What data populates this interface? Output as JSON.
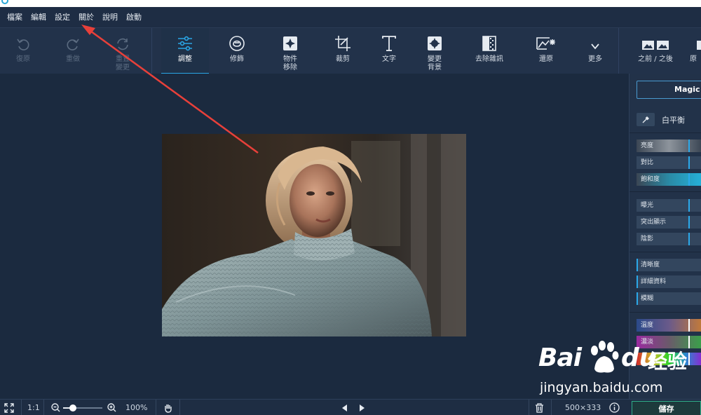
{
  "menu": [
    "檔案",
    "編輯",
    "設定",
    "關於",
    "說明",
    "啟動"
  ],
  "toolbar": {
    "undo": "復原",
    "redo": "重做",
    "reset": "重置\n變更",
    "adjust": "調整",
    "retouch": "修飾",
    "object_removal": "物件\n移除",
    "crop": "裁剪",
    "text": "文字",
    "change_background": "變更\n背景",
    "denoise": "去除雜訊",
    "restore": "還原",
    "more": "更多",
    "before_after": "之前 / 之後",
    "original": "原"
  },
  "panel": {
    "magic_button": "Magic I",
    "white_balance": "白平衡",
    "sliders_tone": [
      "亮度",
      "對比",
      "飽和度"
    ],
    "sliders_light": [
      "曝光",
      "突出顯示",
      "陰影"
    ],
    "sliders_detail": [
      "清晰度",
      "詳細資料",
      "模糊"
    ],
    "sliders_color": [
      "溫度",
      "濃淡"
    ]
  },
  "status": {
    "zoom_ratio": "1:1",
    "zoom_percent": "100%",
    "zoom_value": 0.2,
    "dimensions": "500×333",
    "save": "儲存"
  },
  "watermark": {
    "brand_left": "Bai",
    "brand_right": "du",
    "brand_cn": "经验",
    "url": "jingyan.baidu.com"
  },
  "colors": {
    "accent": "#2aa6e6",
    "save_border": "#2fae8a",
    "annotation_arrow": "#e8403a"
  },
  "icons": [
    "undo-icon",
    "redo-icon",
    "reset-icon",
    "sliders-icon",
    "retouch-icon",
    "object-removal-icon",
    "crop-icon",
    "text-icon",
    "background-icon",
    "denoise-icon",
    "restore-icon",
    "chevron-down-icon",
    "before-after-icon",
    "fullscreen-icon",
    "zoom-out-icon",
    "zoom-in-icon",
    "hand-icon",
    "prev-arrow-icon",
    "next-arrow-icon",
    "trash-icon",
    "info-icon",
    "eyedropper-icon"
  ]
}
